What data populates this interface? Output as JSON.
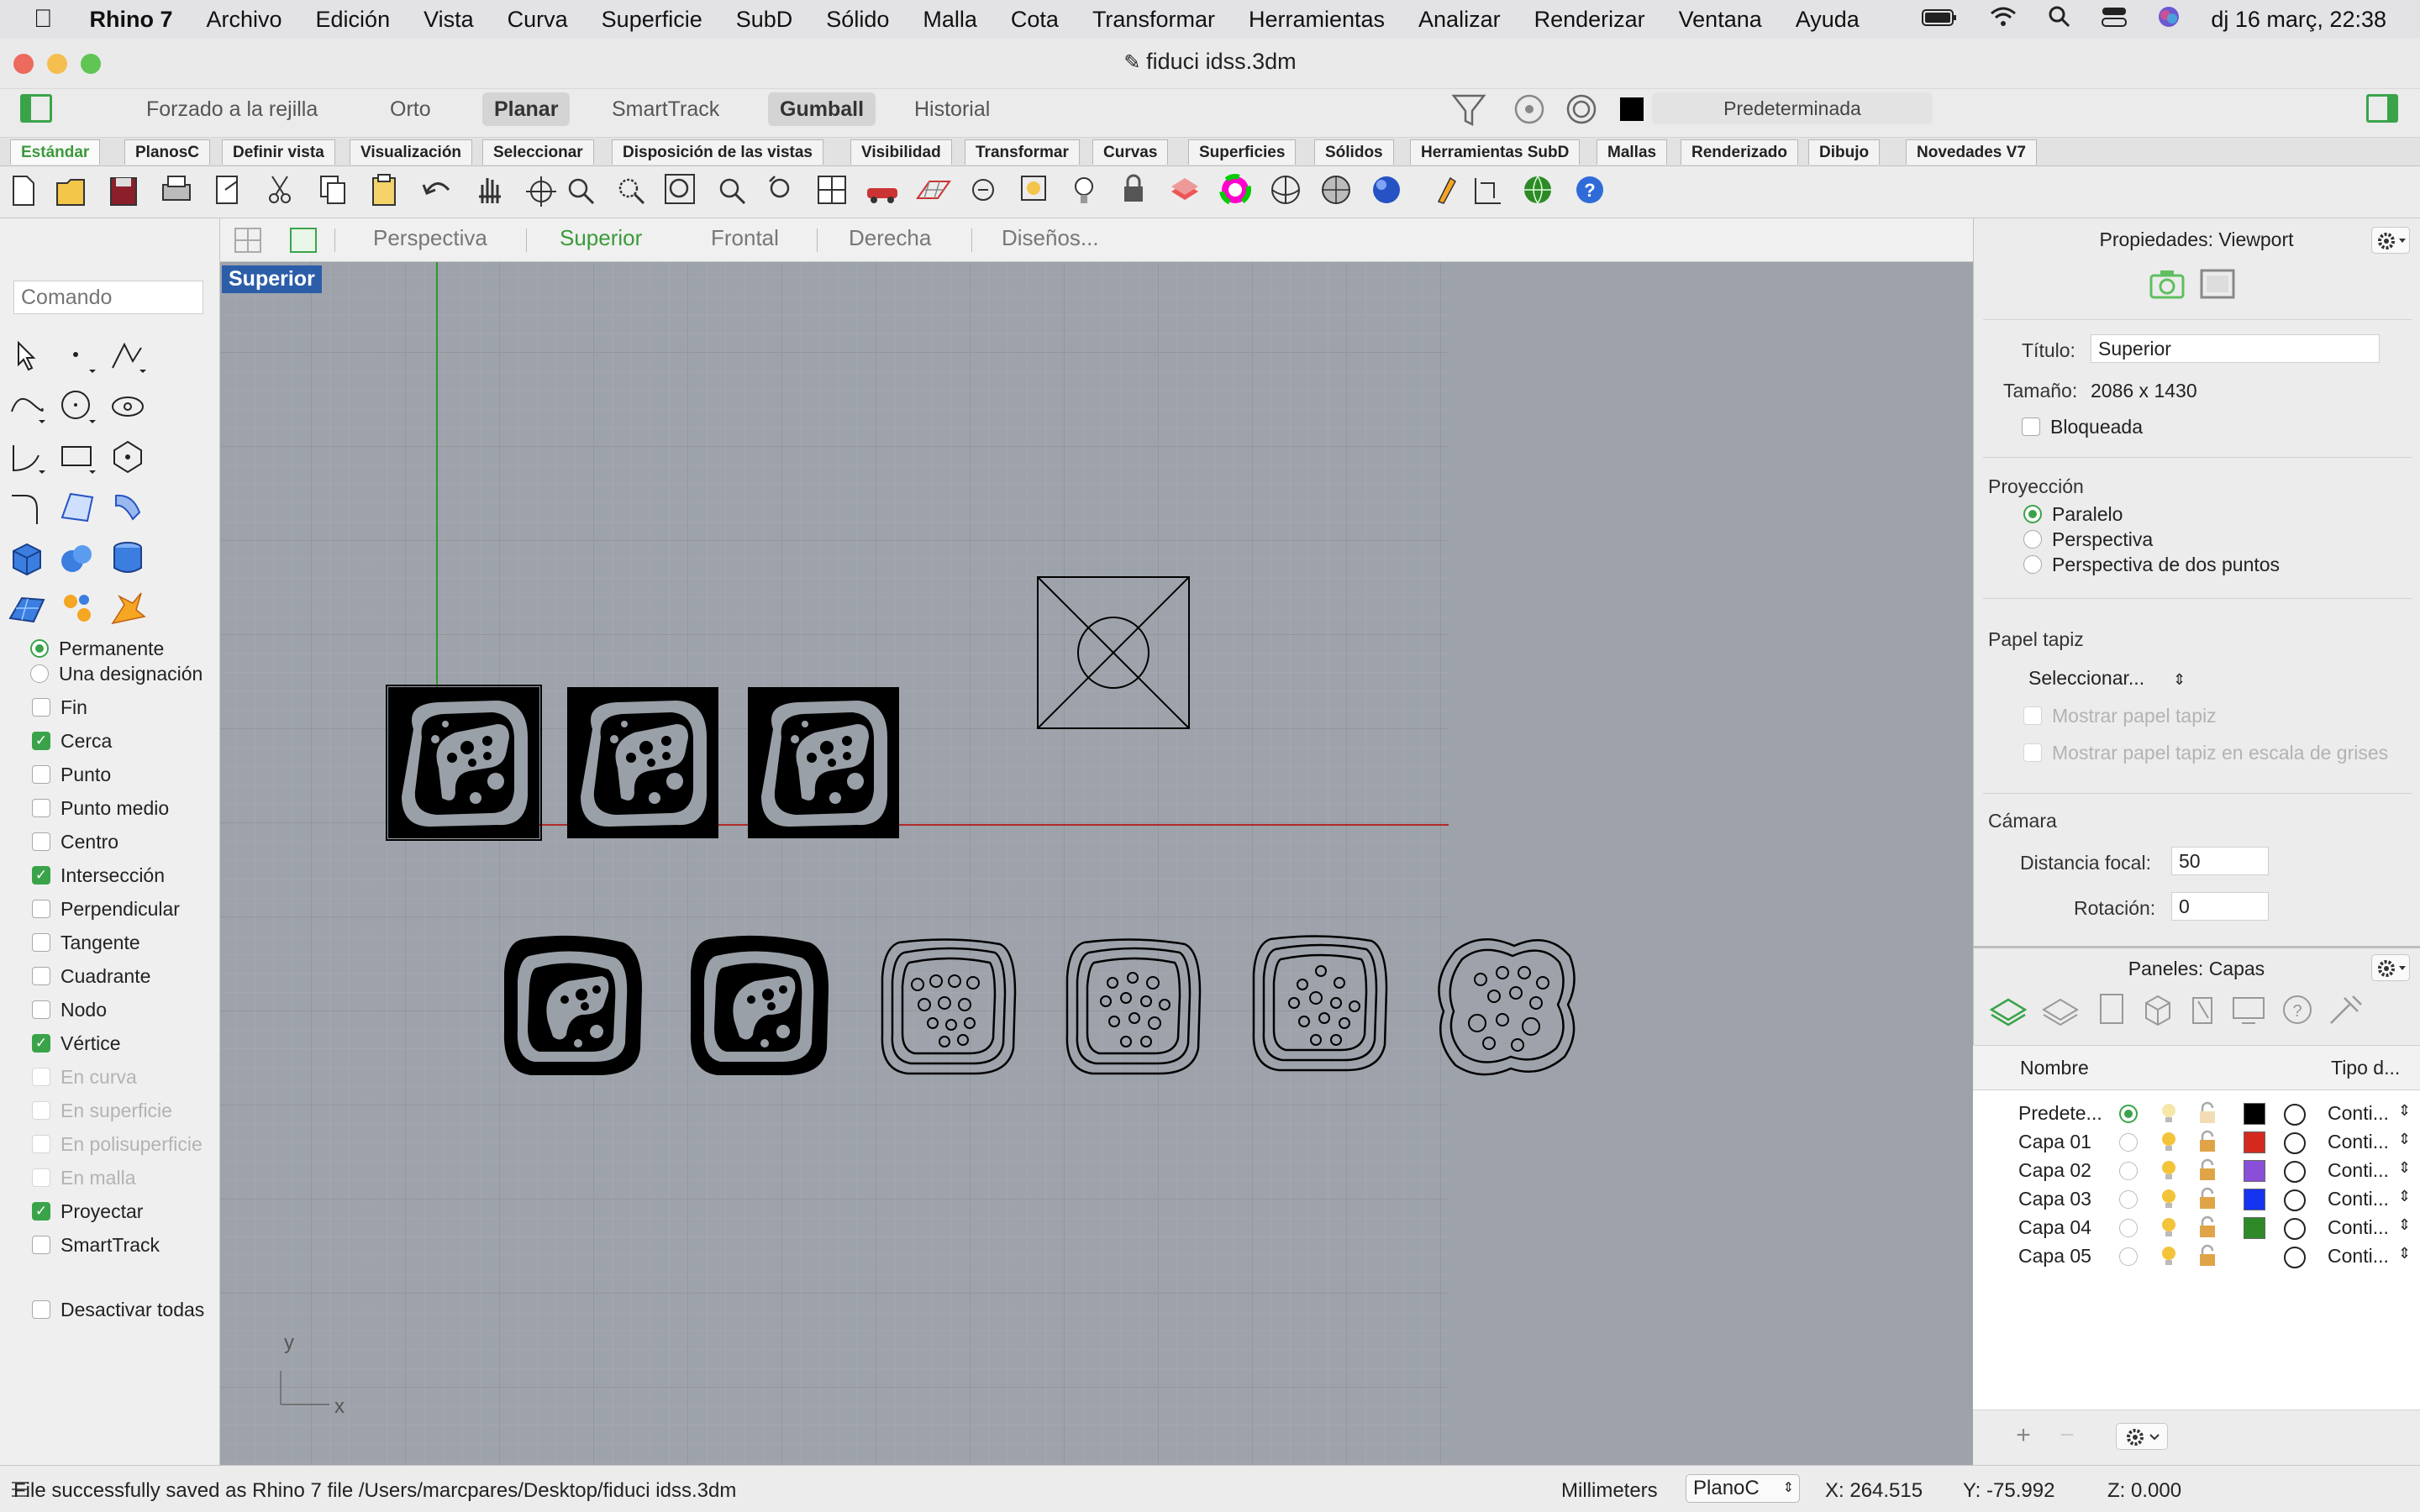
{
  "menubar": {
    "app_name": "Rhino 7",
    "items": [
      "Archivo",
      "Edición",
      "Vista",
      "Curva",
      "Superficie",
      "SubD",
      "Sólido",
      "Malla",
      "Cota",
      "Transformar",
      "Herramientas",
      "Analizar",
      "Renderizar",
      "Ventana",
      "Ayuda"
    ],
    "clock": "dj 16 març, 22:38"
  },
  "window": {
    "title": "fiduci idss.3dm"
  },
  "modes": {
    "grid_snap": "Forzado a la rejilla",
    "ortho": "Orto",
    "planar": "Planar",
    "smarttrack": "SmartTrack",
    "gumball": "Gumball",
    "history": "Historial",
    "layer_display": "Predeterminada"
  },
  "tabs": [
    "Estándar",
    "PlanosC",
    "Definir vista",
    "Visualización",
    "Seleccionar",
    "Disposición de las vistas",
    "Visibilidad",
    "Transformar",
    "Curvas",
    "Superficies",
    "Sólidos",
    "Herramientas SubD",
    "Mallas",
    "Renderizado",
    "Dibujo",
    "Novedades V7"
  ],
  "command": {
    "placeholder": "Comando"
  },
  "osnap": {
    "radio_permanent": "Permanente",
    "radio_once": "Una designación",
    "items": [
      {
        "label": "Fin",
        "checked": false,
        "enabled": true
      },
      {
        "label": "Cerca",
        "checked": true,
        "enabled": true
      },
      {
        "label": "Punto",
        "checked": false,
        "enabled": true
      },
      {
        "label": "Punto medio",
        "checked": false,
        "enabled": true
      },
      {
        "label": "Centro",
        "checked": false,
        "enabled": true
      },
      {
        "label": "Intersección",
        "checked": true,
        "enabled": true
      },
      {
        "label": "Perpendicular",
        "checked": false,
        "enabled": true
      },
      {
        "label": "Tangente",
        "checked": false,
        "enabled": true
      },
      {
        "label": "Cuadrante",
        "checked": false,
        "enabled": true
      },
      {
        "label": "Nodo",
        "checked": false,
        "enabled": true
      },
      {
        "label": "Vértice",
        "checked": true,
        "enabled": true
      },
      {
        "label": "En curva",
        "checked": false,
        "enabled": false
      },
      {
        "label": "En superficie",
        "checked": false,
        "enabled": false
      },
      {
        "label": "En polisuperficie",
        "checked": false,
        "enabled": false
      },
      {
        "label": "En malla",
        "checked": false,
        "enabled": false
      },
      {
        "label": "Proyectar",
        "checked": true,
        "enabled": true
      },
      {
        "label": "SmartTrack",
        "checked": false,
        "enabled": true
      }
    ],
    "disable_all": "Desactivar todas"
  },
  "viewport_tabs": [
    "Perspectiva",
    "Superior",
    "Frontal",
    "Derecha",
    "Diseños..."
  ],
  "viewport": {
    "label": "Superior",
    "axis_x": "x",
    "axis_y": "y"
  },
  "properties": {
    "header": "Propiedades: Viewport",
    "title_label": "Título:",
    "title_value": "Superior",
    "size_label": "Tamaño:",
    "size_value": "2086 x 1430",
    "locked_label": "Bloqueada",
    "projection_header": "Proyección",
    "proj_parallel": "Paralelo",
    "proj_perspective": "Perspectiva",
    "proj_two_point": "Perspectiva de dos puntos",
    "wallpaper_header": "Papel tapiz",
    "wallpaper_select": "Seleccionar...",
    "show_wallpaper": "Mostrar papel tapiz",
    "show_wallpaper_gray": "Mostrar papel tapiz en escala de grises",
    "camera_header": "Cámara",
    "focal_label": "Distancia focal:",
    "focal_value": "50",
    "rotation_label": "Rotación:",
    "rotation_value": "0"
  },
  "layers": {
    "header": "Paneles: Capas",
    "col_name": "Nombre",
    "col_type": "Tipo d...",
    "rows": [
      {
        "name": "Predete...",
        "color": "#000000",
        "type": "Conti...",
        "current": true
      },
      {
        "name": "Capa 01",
        "color": "#d42a1e",
        "type": "Conti...",
        "current": false
      },
      {
        "name": "Capa 02",
        "color": "#8a4fd8",
        "type": "Conti...",
        "current": false
      },
      {
        "name": "Capa 03",
        "color": "#1434f0",
        "type": "Conti...",
        "current": false
      },
      {
        "name": "Capa 04",
        "color": "#2e8a26",
        "type": "Conti...",
        "current": false
      },
      {
        "name": "Capa 05",
        "color": "",
        "type": "Conti...",
        "current": false
      }
    ]
  },
  "status": {
    "message": "File successfully saved as Rhino 7 file /Users/marcpares/Desktop/fiduci idss.3dm",
    "units": "Millimeters",
    "cplane": "PlanoC",
    "x": "X: 264.515",
    "y": "Y: -75.992",
    "z": "Z: 0.000"
  }
}
